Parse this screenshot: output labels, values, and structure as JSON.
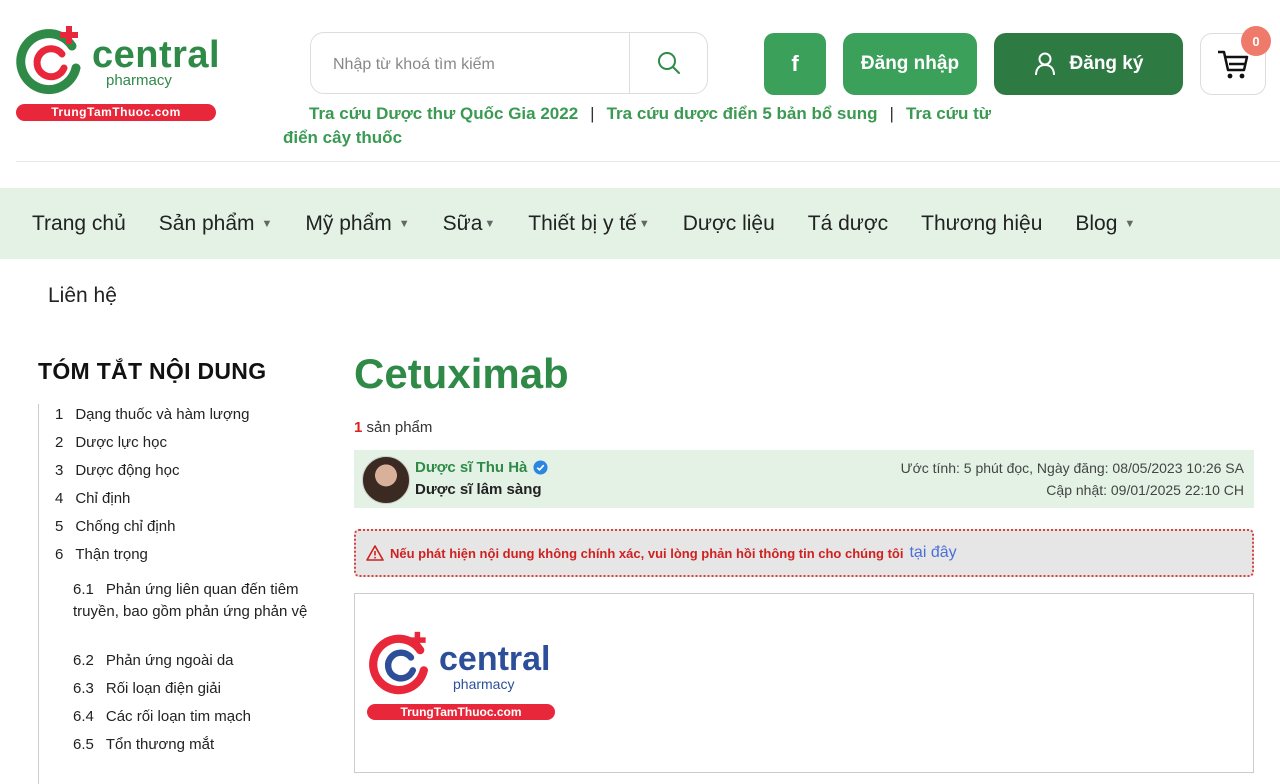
{
  "header": {
    "logo": {
      "brand": "central",
      "sub": "pharmacy",
      "domain": "TrungTamThuoc.com"
    },
    "search": {
      "placeholder": "Nhập từ khoá tìm kiếm"
    },
    "facebook_label": "f",
    "login_label": "Đăng nhập",
    "register_label": "Đăng ký",
    "cart_count": "0",
    "quicklinks": [
      "Tra cứu Dược thư Quốc Gia 2022",
      "Tra cứu dược điển 5 bản bổ sung",
      "Tra cứu từ điển cây thuốc"
    ]
  },
  "nav": {
    "items": [
      {
        "label": "Trang chủ"
      },
      {
        "label": "Sản phẩm"
      },
      {
        "label": "Mỹ phẩm"
      },
      {
        "label": "Sữa"
      },
      {
        "label": "Thiết bị y tế"
      },
      {
        "label": "Dược liệu"
      },
      {
        "label": "Tá dược"
      },
      {
        "label": "Thương hiệu"
      },
      {
        "label": "Blog"
      }
    ],
    "second_row": "Liên hệ"
  },
  "toc": {
    "title": "TÓM TẮT NỘI DUNG",
    "items": [
      {
        "num": "1",
        "label": "Dạng thuốc và hàm lượng"
      },
      {
        "num": "2",
        "label": "Dược lực học"
      },
      {
        "num": "3",
        "label": "Dược động học"
      },
      {
        "num": "4",
        "label": "Chỉ định"
      },
      {
        "num": "5",
        "label": "Chống chỉ định"
      },
      {
        "num": "6",
        "label": "Thận trọng"
      }
    ],
    "subitems": [
      {
        "num": "6.1",
        "label": "Phản ứng liên quan đến tiêm truyền, bao gồm phản ứng phản vệ"
      },
      {
        "num": "6.2",
        "label": "Phản ứng ngoài da"
      },
      {
        "num": "6.3",
        "label": "Rối loạn điện giải"
      },
      {
        "num": "6.4",
        "label": "Các rối loạn tim mạch"
      },
      {
        "num": "6.5",
        "label": "Tổn thương mắt"
      }
    ]
  },
  "article": {
    "title": "Cetuximab",
    "product_count": "1",
    "product_count_label": " sản phẩm",
    "author": {
      "name": "Dược sĩ Thu Hà",
      "role": "Dược sĩ lâm sàng",
      "meta_line1": "Ước tính: 5 phút đọc, Ngày đăng: 08/05/2023 10:26 SA",
      "meta_line2": "Cập nhật: 09/01/2025 22:10 CH"
    },
    "warning": "Nếu phát hiện nội dung không chính xác, vui lòng phản hồi thông tin cho chúng tôi",
    "warning_link": "tại đây"
  },
  "colors": {
    "green": "#2f8a48",
    "button_green": "#3aa05a",
    "dark_green": "#2d7a43",
    "nav_bg": "#e3f2e5",
    "red": "#e8283a"
  }
}
